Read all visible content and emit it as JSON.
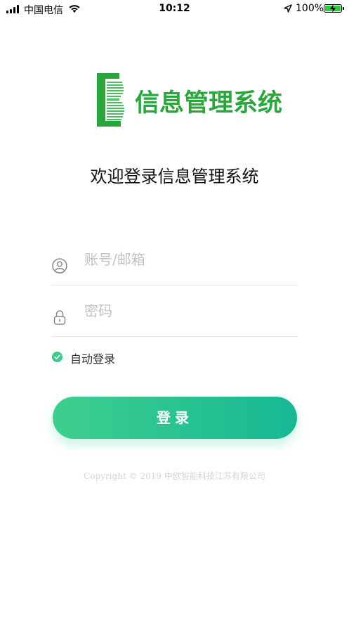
{
  "status_bar": {
    "carrier": "中国电信",
    "time": "10:12",
    "battery": "100%",
    "battery_level": 1.0,
    "icons": [
      "signal-icon",
      "wifi-icon",
      "location-icon",
      "battery-icon"
    ]
  },
  "logo": {
    "text": "信息管理系统",
    "color": "#2aa63c"
  },
  "welcome": "欢迎登录信息管理系统",
  "form": {
    "account_placeholder": "账号/邮箱",
    "password_placeholder": "密码",
    "remember_label": "自动登录",
    "remember_checked": true,
    "login_button": "登录"
  },
  "footer": {
    "copyright": "Copyright © 2019 中欧智能科技江苏有限公司"
  },
  "colors": {
    "accent": "#2ecc8f",
    "button_start": "#3ecf8e",
    "button_end": "#16b894"
  }
}
